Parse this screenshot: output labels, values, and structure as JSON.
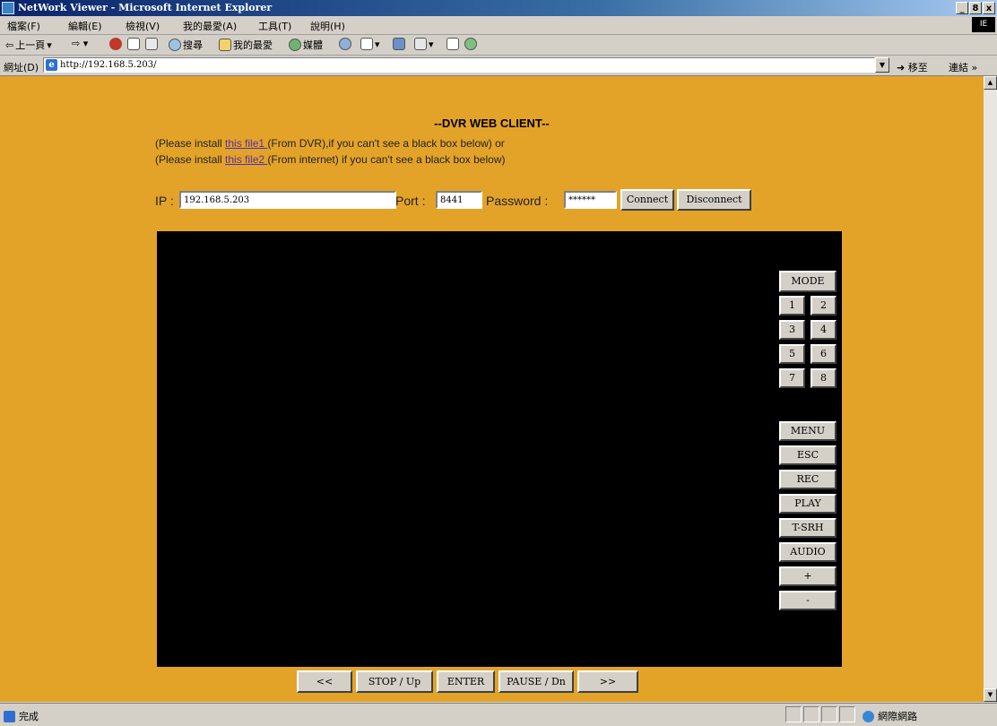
{
  "window": {
    "title": "NetWork Viewer - Microsoft Internet Explorer",
    "controls": [
      "_",
      "8",
      "x"
    ]
  },
  "menu": {
    "items": [
      "檔案(F)",
      "編輯(E)",
      "檢視(V)",
      "我的最愛(A)",
      "工具(T)",
      "說明(H)"
    ],
    "logo_text": "IE"
  },
  "toolbar": {
    "back": "上一頁",
    "search": "搜尋",
    "favorites": "我的最愛",
    "media": "媒體"
  },
  "address": {
    "label": "網址(D)",
    "url": "http://192.168.5.203/",
    "go": "移至",
    "links": "連結 »"
  },
  "page": {
    "heading": "--DVR WEB CLIENT--",
    "line1": {
      "pre": "(Please install ",
      "link": "this file1 ",
      "post": "(From DVR),if you can't see a black box below) or"
    },
    "line2": {
      "pre": "(Please install ",
      "link": "this file2 ",
      "post": "(From internet) if you can't see a black box below)"
    },
    "form": {
      "ip_label": "IP :",
      "ip_value": "192.168.5.203",
      "port_label": "Port :",
      "port_value": "8441",
      "password_label": "Password :",
      "password_value": "******",
      "connect": "Connect",
      "disconnect": "Disconnect"
    },
    "panel": {
      "mode": "MODE",
      "channels": [
        "1",
        "2",
        "3",
        "4",
        "5",
        "6",
        "7",
        "8"
      ],
      "functions": [
        "MENU",
        "ESC",
        "REC",
        "PLAY",
        "T-SRH",
        "AUDIO",
        "+",
        "-"
      ]
    },
    "nav": {
      "prev": "<<",
      "stop": "STOP / Up",
      "enter": "ENTER",
      "pause": "PAUSE / Dn",
      "next": ">>"
    }
  },
  "status": {
    "text": "完成",
    "zone": "網際網路"
  },
  "colors": {
    "page_bg": "#e3a329",
    "video_bg": "#000000",
    "link": "#5a2ea6",
    "title_bar": "#0a246a"
  }
}
